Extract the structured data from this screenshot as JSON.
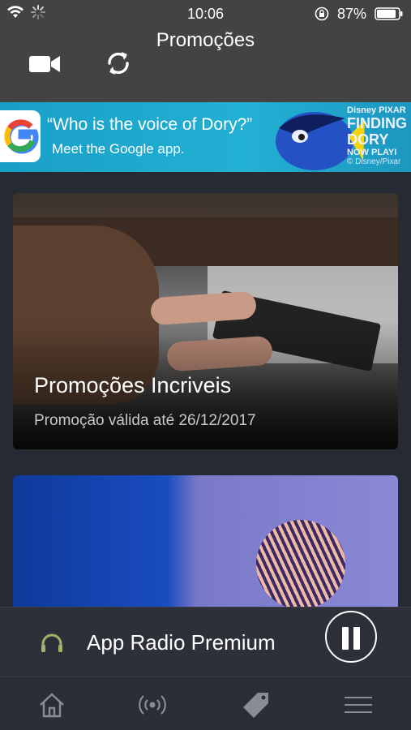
{
  "status_bar": {
    "time": "10:06",
    "battery": "87%"
  },
  "header": {
    "title": "Promoções"
  },
  "ad": {
    "question": "“Who is the voice of Dory?”",
    "subtitle": "Meet the Google app.",
    "brand_top": "Disney PIXAR",
    "brand_title_1": "FINDING",
    "brand_title_2": "DORY",
    "brand_now": "NOW PLAYI",
    "brand_copy": "© Disney/Pixar"
  },
  "promotions": [
    {
      "title": "Promoções Incriveis",
      "date": "Promoção válida até 26/12/2017"
    }
  ],
  "player": {
    "station": "App Radio Premium"
  },
  "colors": {
    "header": "#434343",
    "background": "#262a33",
    "accent_icon": "#9bb56a"
  }
}
